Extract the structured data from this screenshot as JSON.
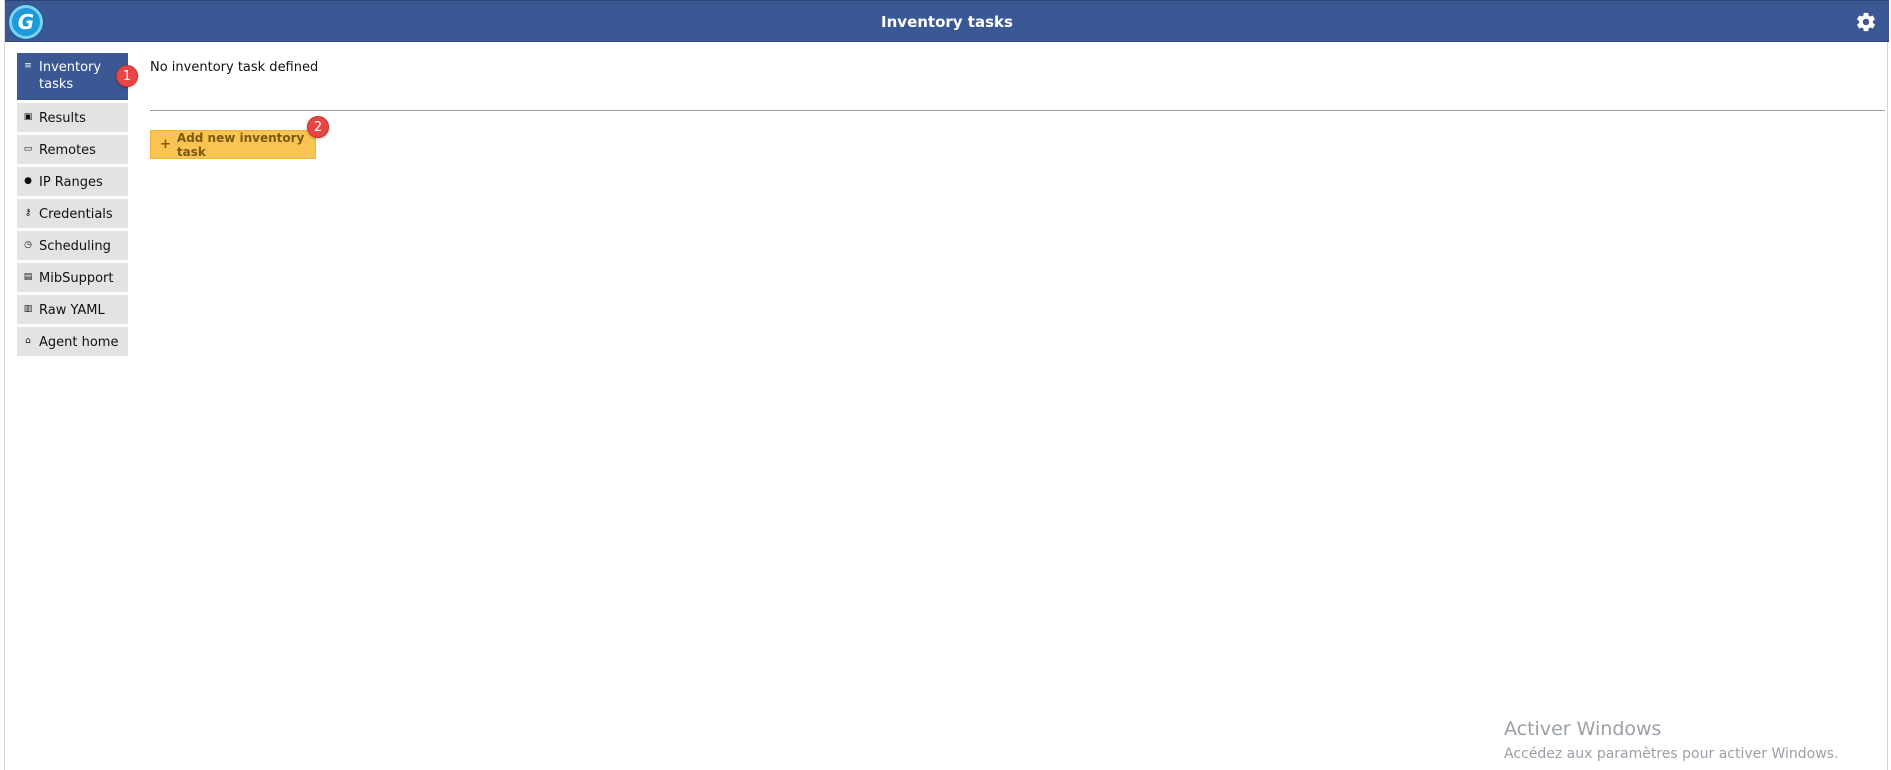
{
  "header": {
    "logo_letter": "G",
    "title": "Inventory tasks",
    "settings_icon": "gear-icon"
  },
  "sidebar": {
    "items": [
      {
        "label": "Inventory tasks",
        "icon": "tasks-icon",
        "glyph": "≡",
        "active": true
      },
      {
        "label": "Results",
        "icon": "results-icon",
        "glyph": "▣"
      },
      {
        "label": "Remotes",
        "icon": "remotes-icon",
        "glyph": "▭"
      },
      {
        "label": "IP Ranges",
        "icon": "network-icon",
        "glyph": "●"
      },
      {
        "label": "Credentials",
        "icon": "key-icon",
        "glyph": "⚷"
      },
      {
        "label": "Scheduling",
        "icon": "clock-icon",
        "glyph": "◷"
      },
      {
        "label": "MibSupport",
        "icon": "mib-icon",
        "glyph": "▤"
      },
      {
        "label": "Raw YAML",
        "icon": "clipboard-icon",
        "glyph": "▥"
      },
      {
        "label": "Agent home",
        "icon": "home-icon",
        "glyph": "⌂"
      }
    ]
  },
  "main": {
    "empty_message": "No inventory task defined",
    "add_button_label": "Add new inventory task",
    "add_button_icon": "+"
  },
  "annotations": {
    "badge_1": "1",
    "badge_2": "2"
  },
  "watermark": {
    "title": "Activer Windows",
    "subtitle": "Accédez aux paramètres pour activer Windows."
  },
  "colors": {
    "header_bg": "#3a5894",
    "nav_active_bg": "#3a5894",
    "nav_bg": "#e3e3e3",
    "button_bg": "#f9c451",
    "badge_bg": "#e84545"
  }
}
